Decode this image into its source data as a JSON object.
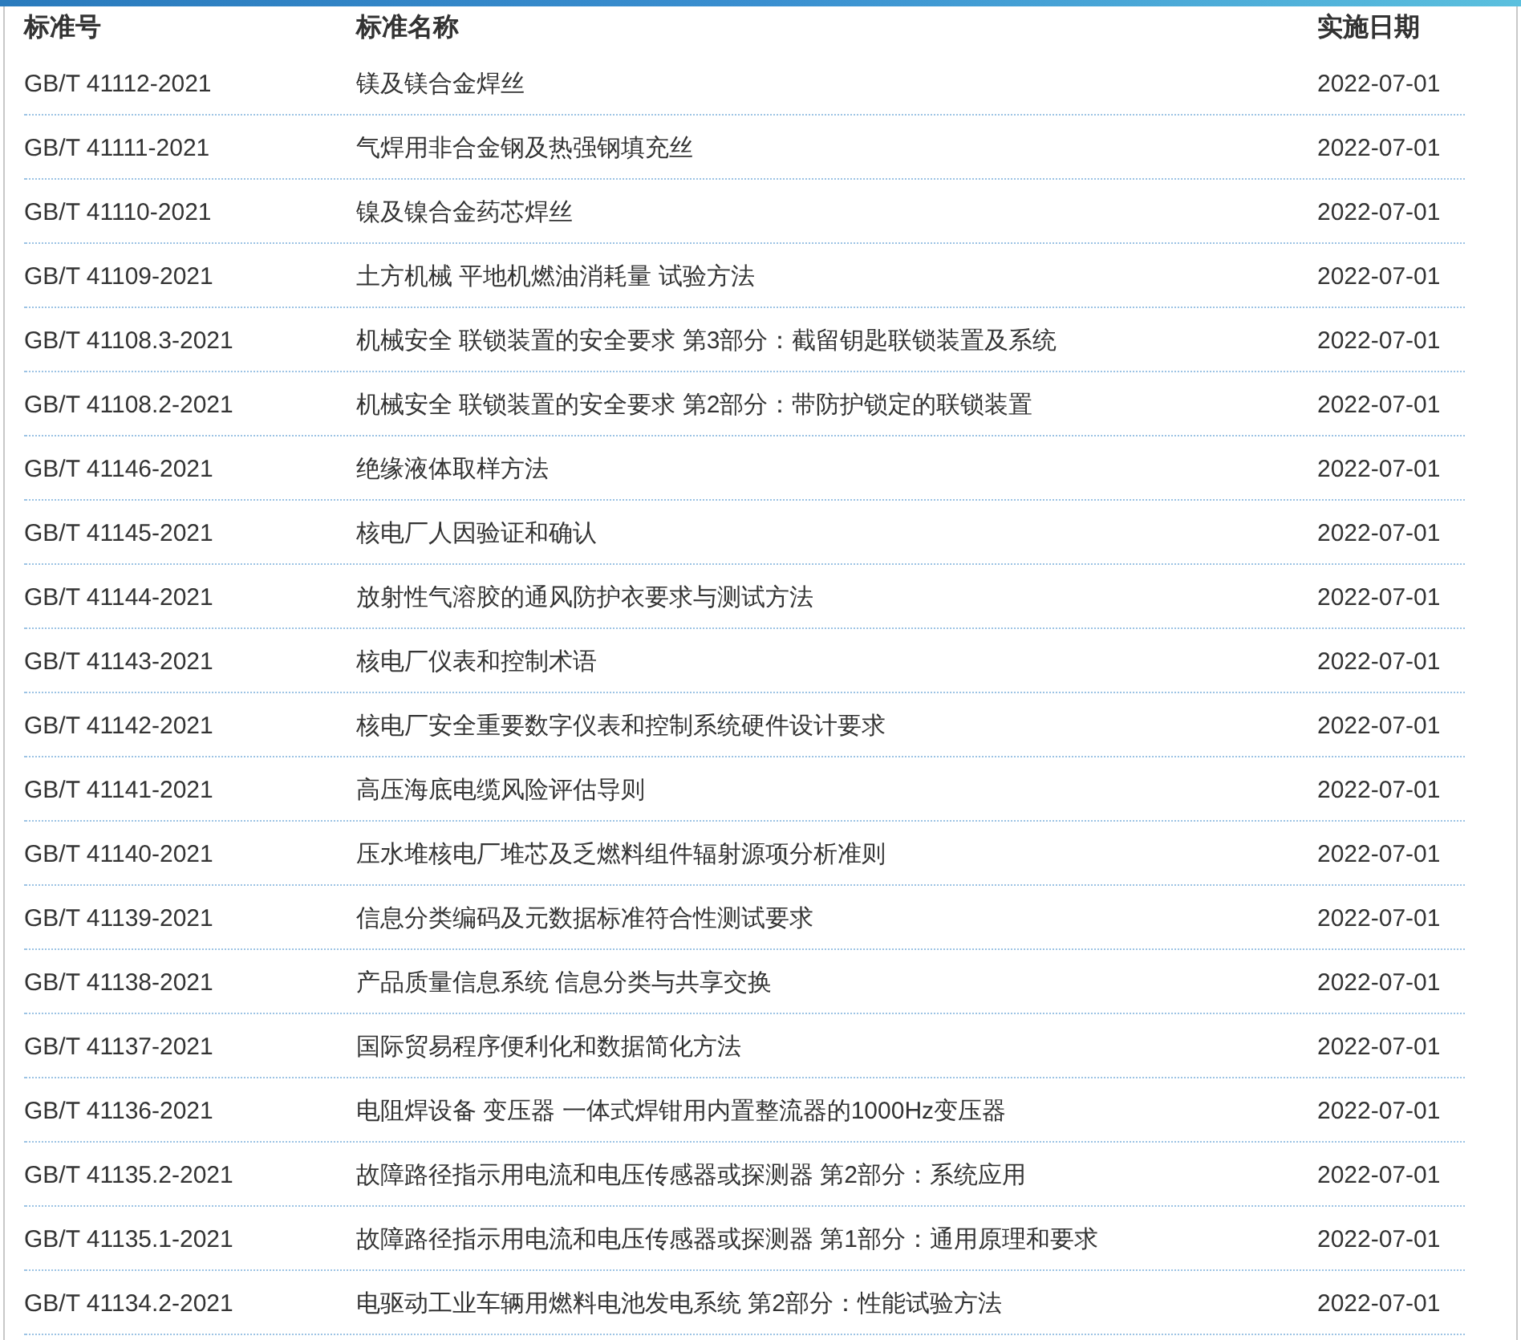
{
  "table": {
    "columns": [
      "标准号",
      "标准名称",
      "实施日期"
    ],
    "rows": [
      [
        "GB/T 41112-2021",
        "镁及镁合金焊丝",
        "2022-07-01"
      ],
      [
        "GB/T 41111-2021",
        "气焊用非合金钢及热强钢填充丝",
        "2022-07-01"
      ],
      [
        "GB/T 41110-2021",
        "镍及镍合金药芯焊丝",
        "2022-07-01"
      ],
      [
        "GB/T 41109-2021",
        "土方机械 平地机燃油消耗量 试验方法",
        "2022-07-01"
      ],
      [
        "GB/T 41108.3-2021",
        "机械安全 联锁装置的安全要求 第3部分：截留钥匙联锁装置及系统",
        "2022-07-01"
      ],
      [
        "GB/T 41108.2-2021",
        "机械安全 联锁装置的安全要求 第2部分：带防护锁定的联锁装置",
        "2022-07-01"
      ],
      [
        "GB/T 41146-2021",
        "绝缘液体取样方法",
        "2022-07-01"
      ],
      [
        "GB/T 41145-2021",
        "核电厂人因验证和确认",
        "2022-07-01"
      ],
      [
        "GB/T 41144-2021",
        "放射性气溶胶的通风防护衣要求与测试方法",
        "2022-07-01"
      ],
      [
        "GB/T 41143-2021",
        "核电厂仪表和控制术语",
        "2022-07-01"
      ],
      [
        "GB/T 41142-2021",
        "核电厂安全重要数字仪表和控制系统硬件设计要求",
        "2022-07-01"
      ],
      [
        "GB/T 41141-2021",
        "高压海底电缆风险评估导则",
        "2022-07-01"
      ],
      [
        "GB/T 41140-2021",
        "压水堆核电厂堆芯及乏燃料组件辐射源项分析准则",
        "2022-07-01"
      ],
      [
        "GB/T 41139-2021",
        "信息分类编码及元数据标准符合性测试要求",
        "2022-07-01"
      ],
      [
        "GB/T 41138-2021",
        "产品质量信息系统 信息分类与共享交换",
        "2022-07-01"
      ],
      [
        "GB/T 41137-2021",
        "国际贸易程序便利化和数据简化方法",
        "2022-07-01"
      ],
      [
        "GB/T 41136-2021",
        "电阻焊设备 变压器 一体式焊钳用内置整流器的1000Hz变压器",
        "2022-07-01"
      ],
      [
        "GB/T 41135.2-2021",
        "故障路径指示用电流和电压传感器或探测器 第2部分：系统应用",
        "2022-07-01"
      ],
      [
        "GB/T 41135.1-2021",
        "故障路径指示用电流和电压传感器或探测器 第1部分：通用原理和要求",
        "2022-07-01"
      ],
      [
        "GB/T 41134.2-2021",
        "电驱动工业车辆用燃料电池发电系统 第2部分：性能试验方法",
        "2022-07-01"
      ]
    ]
  }
}
